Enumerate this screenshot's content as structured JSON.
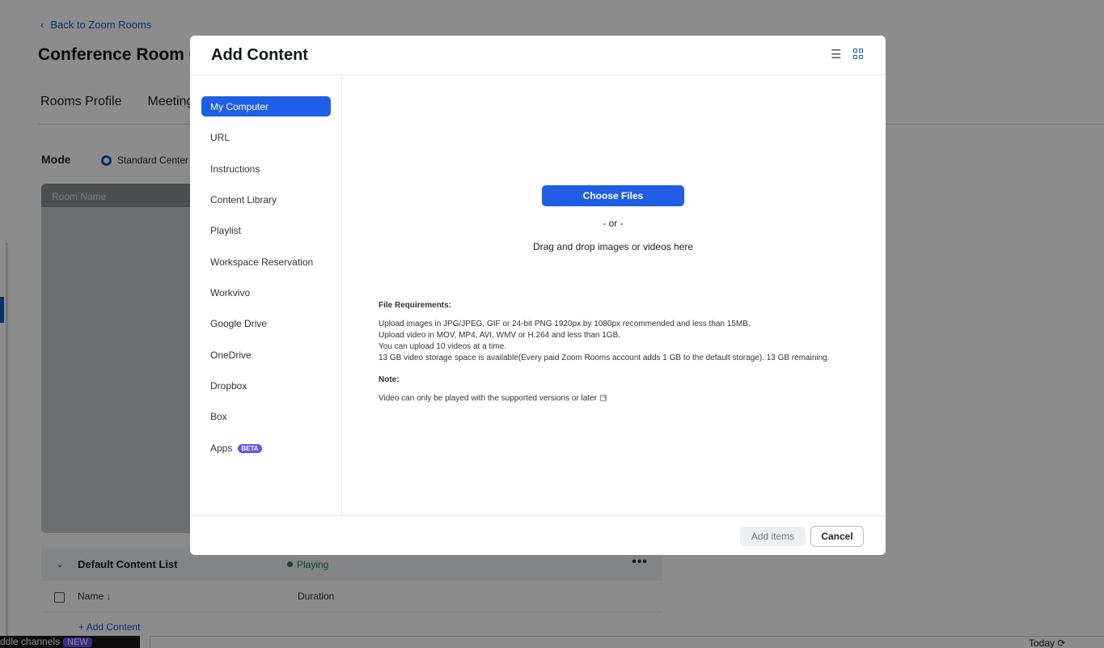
{
  "background": {
    "back_link": "Back to Zoom Rooms",
    "page_title": "Conference Room 0",
    "tabs": [
      "Rooms Profile",
      "Meeting"
    ],
    "mode_label": "Mode",
    "mode_option": "Standard Center",
    "preview_header": "Room Name",
    "default_list": {
      "title": "Default Content List",
      "status": "Playing",
      "more": "•••"
    },
    "columns": {
      "name": "Name",
      "duration": "Duration"
    },
    "add_content": "Add Content",
    "bottom_bar": {
      "text": "ddle channels",
      "badge": "NEW"
    },
    "today": "Today"
  },
  "modal": {
    "title": "Add Content",
    "sidebar": [
      {
        "label": "My Computer",
        "active": true
      },
      {
        "label": "URL"
      },
      {
        "label": "Instructions"
      },
      {
        "label": "Content Library"
      },
      {
        "label": "Playlist"
      },
      {
        "label": "Workspace Reservation"
      },
      {
        "label": "Workvivo"
      },
      {
        "label": "Google Drive"
      },
      {
        "label": "OneDrive"
      },
      {
        "label": "Dropbox"
      },
      {
        "label": "Box"
      },
      {
        "label": "Apps",
        "badge": "BETA"
      }
    ],
    "choose_files": "Choose Files",
    "or": "- or -",
    "drag_drop": "Drag and drop images or videos here",
    "requirements_title": "File Requirements:",
    "requirements": [
      "Upload images in JPG/JPEG, GIF or 24-bit PNG 1920px by 1080px recommended and less than 15MB.",
      "Upload video in MOV, MP4, AVI, WMV or H.264 and less than 1GB.",
      "You can upload 10 videos at a time.",
      "13 GB video storage space is available(Every paid Zoom Rooms account adds 1 GB to the default storage). 13 GB remaining."
    ],
    "note_title": "Note:",
    "note_text": "Video can only be played with the supported versions or later",
    "footer": {
      "add_items": "Add items",
      "cancel": "Cancel"
    }
  },
  "colors": {
    "accent": "#1f5ee6",
    "link": "#0e5cc9",
    "beta": "#6a4ff3",
    "playing": "#1e8a3e"
  }
}
